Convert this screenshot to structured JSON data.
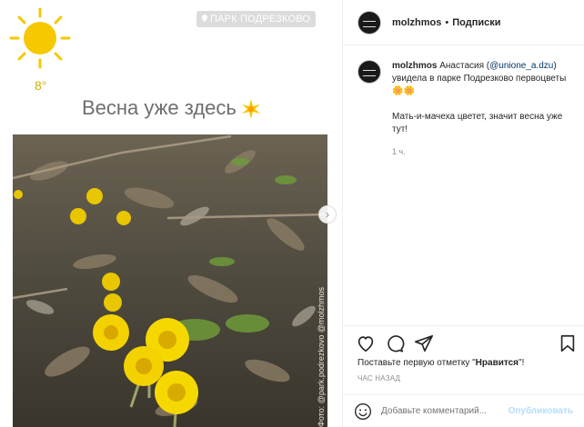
{
  "post_image": {
    "temperature": "8°",
    "location": "ПАРК ПОДРЕЗКОВО",
    "headline": "Весна уже здесь",
    "credit": "Фото: @park.podrezkovo @molzhmos",
    "next_arrow": "›"
  },
  "header": {
    "username": "molzhmos",
    "separator": "•",
    "follow_label": "Подписки"
  },
  "caption": {
    "username": "molzhmos",
    "text_before_mention": "Анастасия (",
    "mention": "@unione_a.dzu",
    "text_after_mention": ") увидела в парке Подрезково первоцветы 🌼🌼",
    "paragraph2": "Мать-и-мачеха цветет, значит весна уже тут!",
    "time": "1 ч."
  },
  "likes": {
    "prefix": "Поставьте первую отметку \"",
    "bold": "Нравится",
    "suffix": "\"!"
  },
  "timestamp": "ЧАС НАЗАД",
  "comment": {
    "placeholder": "Добавьте комментарий...",
    "publish_label": "Опубликовать"
  },
  "colors": {
    "sun": "#f5c800",
    "border": "#efefef",
    "mention": "#00376b",
    "publish": "#b2dffc"
  }
}
